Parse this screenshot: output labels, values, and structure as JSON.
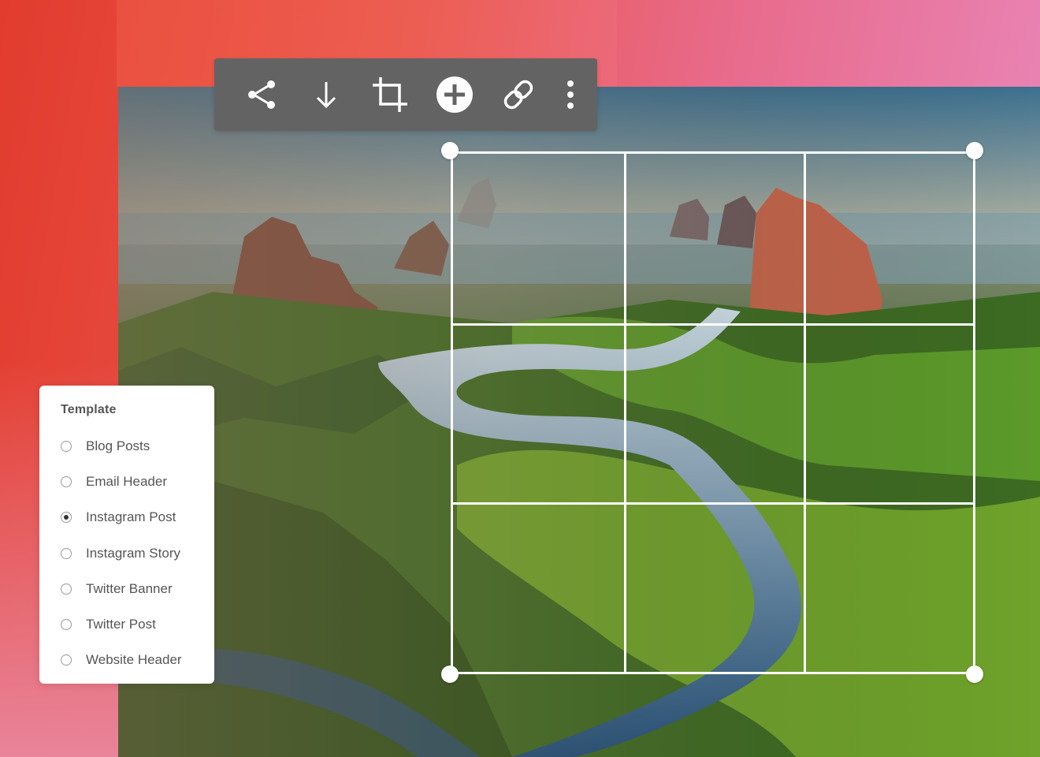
{
  "toolbar": {
    "buttons": [
      {
        "name": "share-icon"
      },
      {
        "name": "download-icon"
      },
      {
        "name": "crop-icon"
      },
      {
        "name": "add-icon"
      },
      {
        "name": "link-icon"
      },
      {
        "name": "more-vertical-icon"
      }
    ]
  },
  "template": {
    "title": "Template",
    "options": [
      {
        "label": "Blog Posts",
        "selected": false
      },
      {
        "label": "Email Header",
        "selected": false
      },
      {
        "label": "Instagram Post",
        "selected": true
      },
      {
        "label": "Instagram Story",
        "selected": false
      },
      {
        "label": "Twitter Banner",
        "selected": false
      },
      {
        "label": "Twitter Post",
        "selected": false
      },
      {
        "label": "Website Header",
        "selected": false
      }
    ]
  },
  "colors": {
    "toolbar_bg": "#636363",
    "crop_frame": "#ffffff",
    "panel_bg": "#ffffff"
  }
}
